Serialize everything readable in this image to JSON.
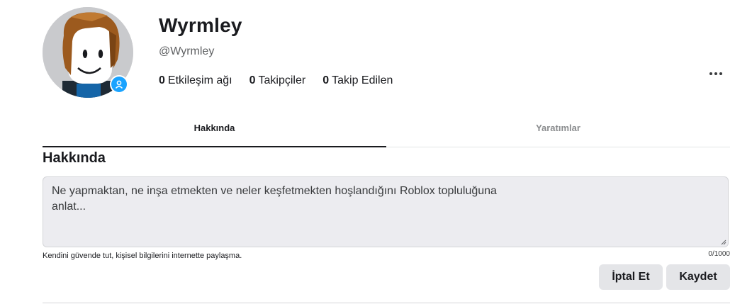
{
  "profile": {
    "display_name": "Wyrmley",
    "username": "@Wyrmley",
    "stats": [
      {
        "count": "0",
        "label": "Etkileşim ağı"
      },
      {
        "count": "0",
        "label": "Takipçiler"
      },
      {
        "count": "0",
        "label": "Takip Edilen"
      }
    ],
    "presence_icon": "user-icon"
  },
  "tabs": [
    {
      "label": "Hakkında",
      "active": true
    },
    {
      "label": "Yaratımlar",
      "active": false
    }
  ],
  "about": {
    "heading": "Hakkında",
    "placeholder": "Ne yapmaktan, ne inşa etmekten ve neler keşfetmekten hoşlandığını Roblox topluluğuna anlat...",
    "safety_note": "Kendini güvende tut, kişisel bilgilerini internette paylaşma.",
    "char_count": "0/1000",
    "cancel_label": "İptal Et",
    "save_label": "Kaydet"
  },
  "colors": {
    "presence": "#1aa3ff",
    "button_bg": "#e4e5e8",
    "input_bg": "#ececf0"
  }
}
